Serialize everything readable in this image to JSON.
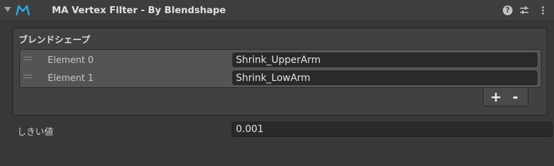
{
  "component": {
    "title": "MA Vertex Filter - By Blendshape",
    "logo_color": "#29a8e0",
    "icons": [
      "help-icon",
      "preset-icon",
      "menu-icon"
    ]
  },
  "blendshapes": {
    "label": "ブレンドシェープ",
    "elements": [
      {
        "label": "Element 0",
        "value": "Shrink_UpperArm"
      },
      {
        "label": "Element 1",
        "value": "Shrink_LowArm"
      }
    ],
    "add_label": "+",
    "remove_label": "-"
  },
  "threshold": {
    "label": "しきい値",
    "value": "0.001"
  }
}
